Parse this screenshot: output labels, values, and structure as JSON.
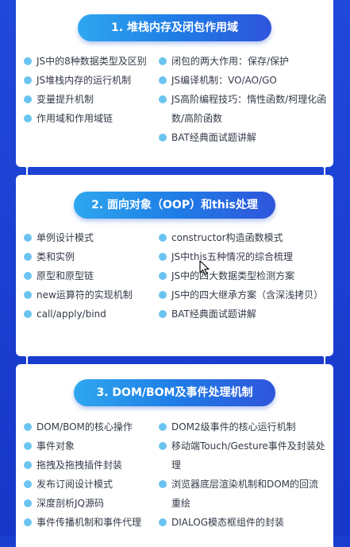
{
  "sections": [
    {
      "title": "1. 堆栈内存及闭包作用域",
      "left": [
        "JS中的8种数据类型及区别",
        "JS堆栈内存的运行机制",
        "变量提升机制",
        "作用域和作用域链"
      ],
      "right": [
        "闭包的两大作用：保存/保护",
        "JS编译机制：VO/AO/GO",
        "JS高阶编程技巧：惰性函数/柯理化函数/高阶函数",
        "BAT经典面试题讲解"
      ]
    },
    {
      "title": "2. 面向对象（OOP）和this处理",
      "left": [
        "单例设计模式",
        "类和实例",
        "原型和原型链",
        "new运算符的实现机制",
        "call/apply/bind"
      ],
      "right": [
        "constructor构造函数模式",
        "JS中this五种情况的综合梳理",
        "JS中的四大数据类型检测方案",
        "JS中的四大继承方案（含深浅拷贝）",
        "BAT经典面试题讲解"
      ]
    },
    {
      "title": "3. DOM/BOM及事件处理机制",
      "left": [
        "DOM/BOM的核心操作",
        "事件对象",
        "拖拽及拖拽插件封装",
        "发布订阅设计模式",
        "深度剖析JQ源码",
        "事件传播机制和事件代理"
      ],
      "right": [
        "DOM2级事件的核心运行机制",
        "移动端Touch/Gesture事件及封装处理",
        "浏览器底层渲染机制和DOM的回流重绘",
        "DIALOG模态框组件的封装"
      ]
    }
  ]
}
